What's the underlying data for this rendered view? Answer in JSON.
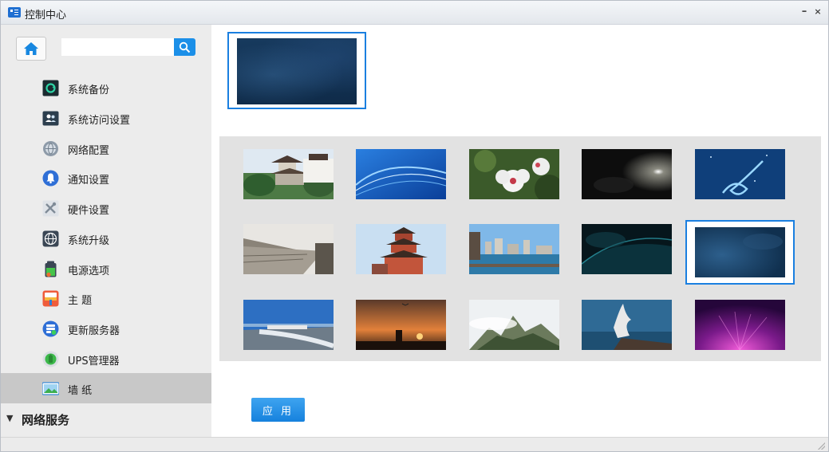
{
  "window": {
    "title": "控制中心",
    "minimize": "–",
    "close": "×"
  },
  "search": {
    "placeholder": "",
    "value": ""
  },
  "sidebar": {
    "items": [
      {
        "label": "系统备份",
        "icon": "backup-icon"
      },
      {
        "label": "系统访问设置",
        "icon": "user-access-icon"
      },
      {
        "label": "网络配置",
        "icon": "network-globe-icon"
      },
      {
        "label": "通知设置",
        "icon": "bell-icon"
      },
      {
        "label": "硬件设置",
        "icon": "tools-icon"
      },
      {
        "label": "系统升级",
        "icon": "globe-upgrade-icon"
      },
      {
        "label": "电源选项",
        "icon": "battery-icon"
      },
      {
        "label": "主 题",
        "icon": "paint-roller-icon"
      },
      {
        "label": "更新服务器",
        "icon": "update-server-icon"
      },
      {
        "label": "UPS管理器",
        "icon": "ups-icon"
      },
      {
        "label": "墙 纸",
        "icon": "wallpaper-icon",
        "active": true
      }
    ],
    "group": {
      "label": "网络服务",
      "expanded": true
    }
  },
  "wallpapers": {
    "selected_index": 9,
    "items": [
      {
        "name": "pavilion-garden"
      },
      {
        "name": "blue-waves"
      },
      {
        "name": "white-hibiscus"
      },
      {
        "name": "dark-light"
      },
      {
        "name": "blue-particles"
      },
      {
        "name": "city-wall-steps"
      },
      {
        "name": "tower-pavilion"
      },
      {
        "name": "waterfront-city"
      },
      {
        "name": "teal-glow"
      },
      {
        "name": "deep-blue"
      },
      {
        "name": "coastal-road"
      },
      {
        "name": "sunset-silhouette"
      },
      {
        "name": "misty-mountain"
      },
      {
        "name": "seaside-bird"
      },
      {
        "name": "purple-light"
      }
    ]
  },
  "actions": {
    "apply_label": "应 用"
  },
  "colors": {
    "accent": "#1a7fe0",
    "button": "#1b8fe8",
    "active_item": "#c8c8c8"
  }
}
